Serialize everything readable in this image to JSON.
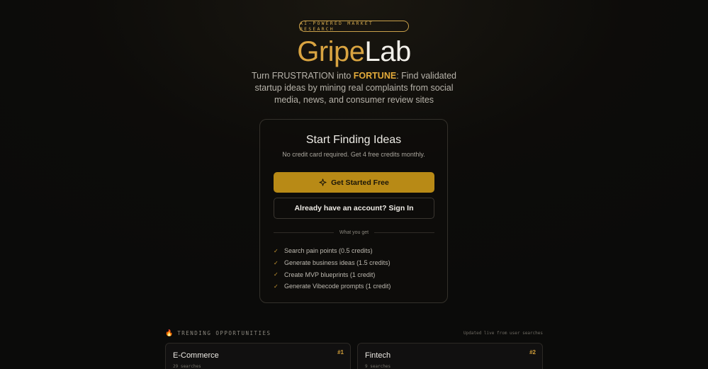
{
  "hero": {
    "badge": "AI-POWERED MARKET RESEARCH",
    "logo_part1": "Gripe",
    "logo_part2": "Lab",
    "tagline_pre": "Turn FRUSTRATION into ",
    "tagline_strong": "FORTUNE",
    "tagline_post": ": Find validated startup ideas by mining real complaints from social media, news, and consumer review sites"
  },
  "signup_card": {
    "title": "Start Finding Ideas",
    "subtitle": "No credit card required. Get 4 free credits monthly.",
    "primary_button": "Get Started Free",
    "secondary_button": "Already have an account? Sign In",
    "divider_label": "What you get",
    "features": [
      "Search pain points (0.5 credits)",
      "Generate business ideas (1.5 credits)",
      "Create MVP blueprints (1 credit)",
      "Generate Vibecode prompts (1 credit)"
    ]
  },
  "trending": {
    "heading": "TRENDING OPPORTUNITIES",
    "updated_note": "Updated live from user searches",
    "items": [
      {
        "name": "E-Commerce",
        "rank": "#1",
        "count": "29 searches"
      },
      {
        "name": "Fintech",
        "rank": "#2",
        "count": "9 searches"
      }
    ]
  },
  "colors": {
    "accent": "#d9a441",
    "button_primary": "#b88a16",
    "background": "#0d0c0a"
  },
  "icons": {
    "primary_button_icon": "sparkle-icon",
    "feature_icon": "check-icon",
    "trending_icon": "fire-icon"
  }
}
